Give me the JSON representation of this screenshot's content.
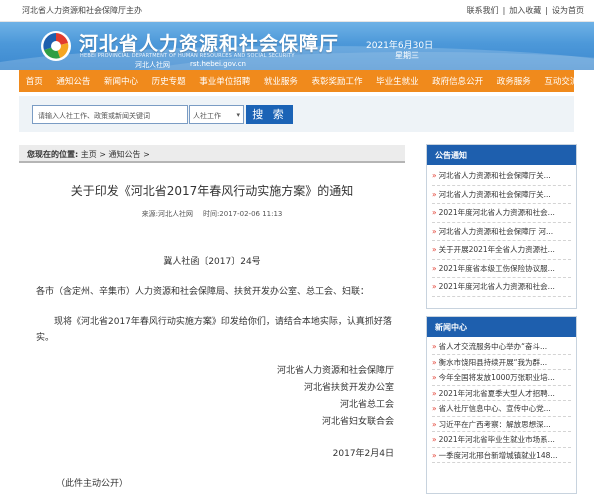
{
  "topbar": {
    "site_name": "河北省人力资源和社会保障厅主办",
    "links": [
      "联系我们",
      "加入收藏",
      "设为首页"
    ],
    "separator": "|"
  },
  "banner": {
    "title": "河北省人力资源和社会保障厅",
    "english": "HEBEI PROVINCIAL DEPARTMENT OF HUMAN RESOURCES AND SOCIAL SECURITY",
    "subname": "河北人社网",
    "url": "rst.hebei.gov.cn",
    "date": "2021年6月30日",
    "weekday": "星期三"
  },
  "nav": [
    "首页",
    "通知公告",
    "新闻中心",
    "历史专题",
    "事业单位招聘",
    "就业服务",
    "表彰奖励工作",
    "毕业生就业",
    "政府信息公开",
    "政务服务",
    "互动交流"
  ],
  "search": {
    "placeholder": "请输入人社工作、政策或新闻关键词",
    "select_value": "人社工作",
    "button": "搜 索"
  },
  "breadcrumb": {
    "label": "您现在的位置:",
    "path": "主页 > 通知公告 >"
  },
  "article": {
    "title": "关于印发《河北省2017年春风行动实施方案》的通知",
    "source": "来源:河北人社网",
    "time": "时间:2017-02-06 11:13",
    "doc_no": "冀人社函〔2017〕24号",
    "para1": "各市（含定州、辛集市）人力资源和社会保障局、扶贫开发办公室、总工会、妇联：",
    "para2": "现将《河北省2017年春风行动实施方案》印发给你们，请结合本地实际，认真抓好落实。",
    "signatures": [
      "河北省人力资源和社会保障厅",
      "河北省扶贫开发办公室",
      "河北省总工会",
      "河北省妇女联合会"
    ],
    "date": "2017年2月4日",
    "note": "（此件主动公开）"
  },
  "sidebar": {
    "notice": {
      "title": "公告通知",
      "items": [
        "河北省人力资源和社会保障厅关...",
        "河北省人力资源和社会保障厅关...",
        "2021年度河北省人力资源和社会...",
        "河北省人力资源和社会保障厅 河...",
        "关于开展2021年全省人力资源社...",
        "2021年度省本级工伤保险协议服...",
        "2021年度河北省人力资源和社会..."
      ]
    },
    "news": {
      "title": "新闻中心",
      "items": [
        "省人才交流服务中心举办“奋斗...",
        "衡水市饶阳县持续开展“我为群...",
        "今年全国将发放1000万张职业培...",
        "2021年河北省夏季大型人才招聘...",
        "省人社厅信息中心、宣传中心党...",
        "习近平在广西考察：解放思想深...",
        "2021年河北省毕业生就业市场系...",
        "一季度河北邢台新增城镇就业148..."
      ]
    }
  },
  "colors": {
    "nav_orange": "#f08a1c",
    "header_blue": "#1e5fae",
    "banner_blue": "#4c98d9",
    "search_button": "#1b63b6",
    "bullet_red": "#e23b2e"
  }
}
